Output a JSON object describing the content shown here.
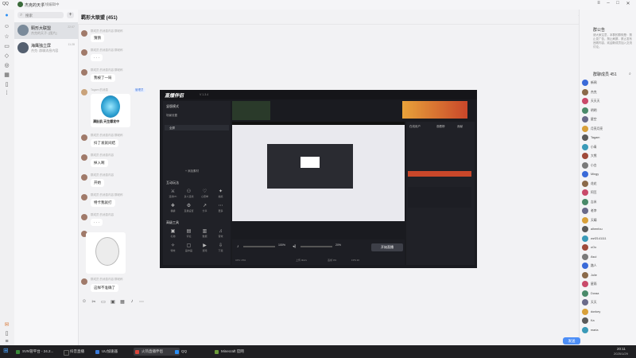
{
  "app": {
    "logo": "QQ",
    "user_name": "杰克的天子",
    "user_status": "在线编辑中"
  },
  "chat_list": {
    "search_placeholder": "搜索",
    "items": [
      {
        "title": "羁形大联盟",
        "snippet": "杰克的天子: [图片]",
        "time": "22:07"
      },
      {
        "title": "海鹰独立屏",
        "snippet": "杰克: 群聊消息内容",
        "time": "11:28"
      }
    ]
  },
  "chat": {
    "title": "羁形大联盟 (451)",
    "messages": [
      {
        "meta": "群成员 的消息内容 群昵称",
        "text": "猜猜"
      },
      {
        "meta": "群成员 的消息内容 群昵称",
        "text": "· · ·"
      },
      {
        "meta": "群成员 的消息内容 群昵称",
        "text": "我被了一局"
      },
      {
        "meta": "Tagam 的消息",
        "sticker_caption": "满肚肌 天生爆发中",
        "tag": "管理员"
      },
      {
        "meta": "群成员 的消息内容 群昵称",
        "text": "抖了发就间结"
      },
      {
        "meta": "群成员 的消息内容",
        "text": "掉入啊"
      },
      {
        "meta": "群成员 的消息内容",
        "text": "开始"
      },
      {
        "meta": "群成员 的消息内容 群昵称",
        "text": "特卡我就打"
      },
      {
        "meta": "群成员 的消息内容",
        "text": "· · ·"
      },
      {
        "meta": "群成员 的消息内容 群昵称",
        "text": "这样不准确了"
      }
    ]
  },
  "right_panel": {
    "announcement_title": "群公告",
    "announcement_text": "请大家注意，本群的群规是：禁止发广告，禁止刷屏，禁止发布违规内容，欢迎新成员加入交流讨论。",
    "members_title": "群聊成员 451",
    "members": [
      "新闻",
      "杰克",
      "天天天",
      "明明",
      "星空",
      "月亮月亮",
      "Tagam",
      "小青",
      "大熊",
      "小白",
      "Mingy",
      "花花",
      "阿豆",
      "吉米",
      "老李",
      "天晴",
      "aihenfou",
      "wzf2141111",
      "oOo",
      "Asui",
      "路人",
      "Julie",
      "星雨",
      "Doraa",
      "天天",
      "donkey",
      "Ka",
      "maria"
    ],
    "send_button": "发送"
  },
  "embedded": {
    "brand": "直播伴侣",
    "version": "V 1.3.4",
    "mode_label": "竖版模式",
    "section_scene": "场景设置",
    "scene_name": "全屏",
    "add_scene": "+ 添加素材",
    "section_interact": "互动玩法",
    "interact_tools": [
      "连线PK",
      "多人连线",
      "心愿单",
      "抽奖",
      "福袋",
      "直播设置",
      "分享",
      "更多"
    ],
    "section_advanced": "高级工具",
    "advanced_tools": [
      "礼物",
      "评论",
      "数据",
      "音效",
      "特效",
      "画中画",
      "游戏",
      "下载"
    ],
    "right_tabs": [
      "在线用户",
      "观看榜",
      "贡献"
    ],
    "volume_mic": "100%",
    "volume_speaker": "20%",
    "start_button": "开始直播",
    "cpu": "CPU 15%",
    "stats": [
      "上传 0kb/s",
      "丢帧 0%",
      "FPS 30"
    ]
  },
  "taskbar": {
    "items": [
      "SVN管平台 - 24.2...",
      "抖音直播",
      "UU加速器",
      "火热直播伴侣",
      "QQ",
      "Minecraft 官网"
    ],
    "time": "20:11",
    "date": "2025/1/29"
  }
}
